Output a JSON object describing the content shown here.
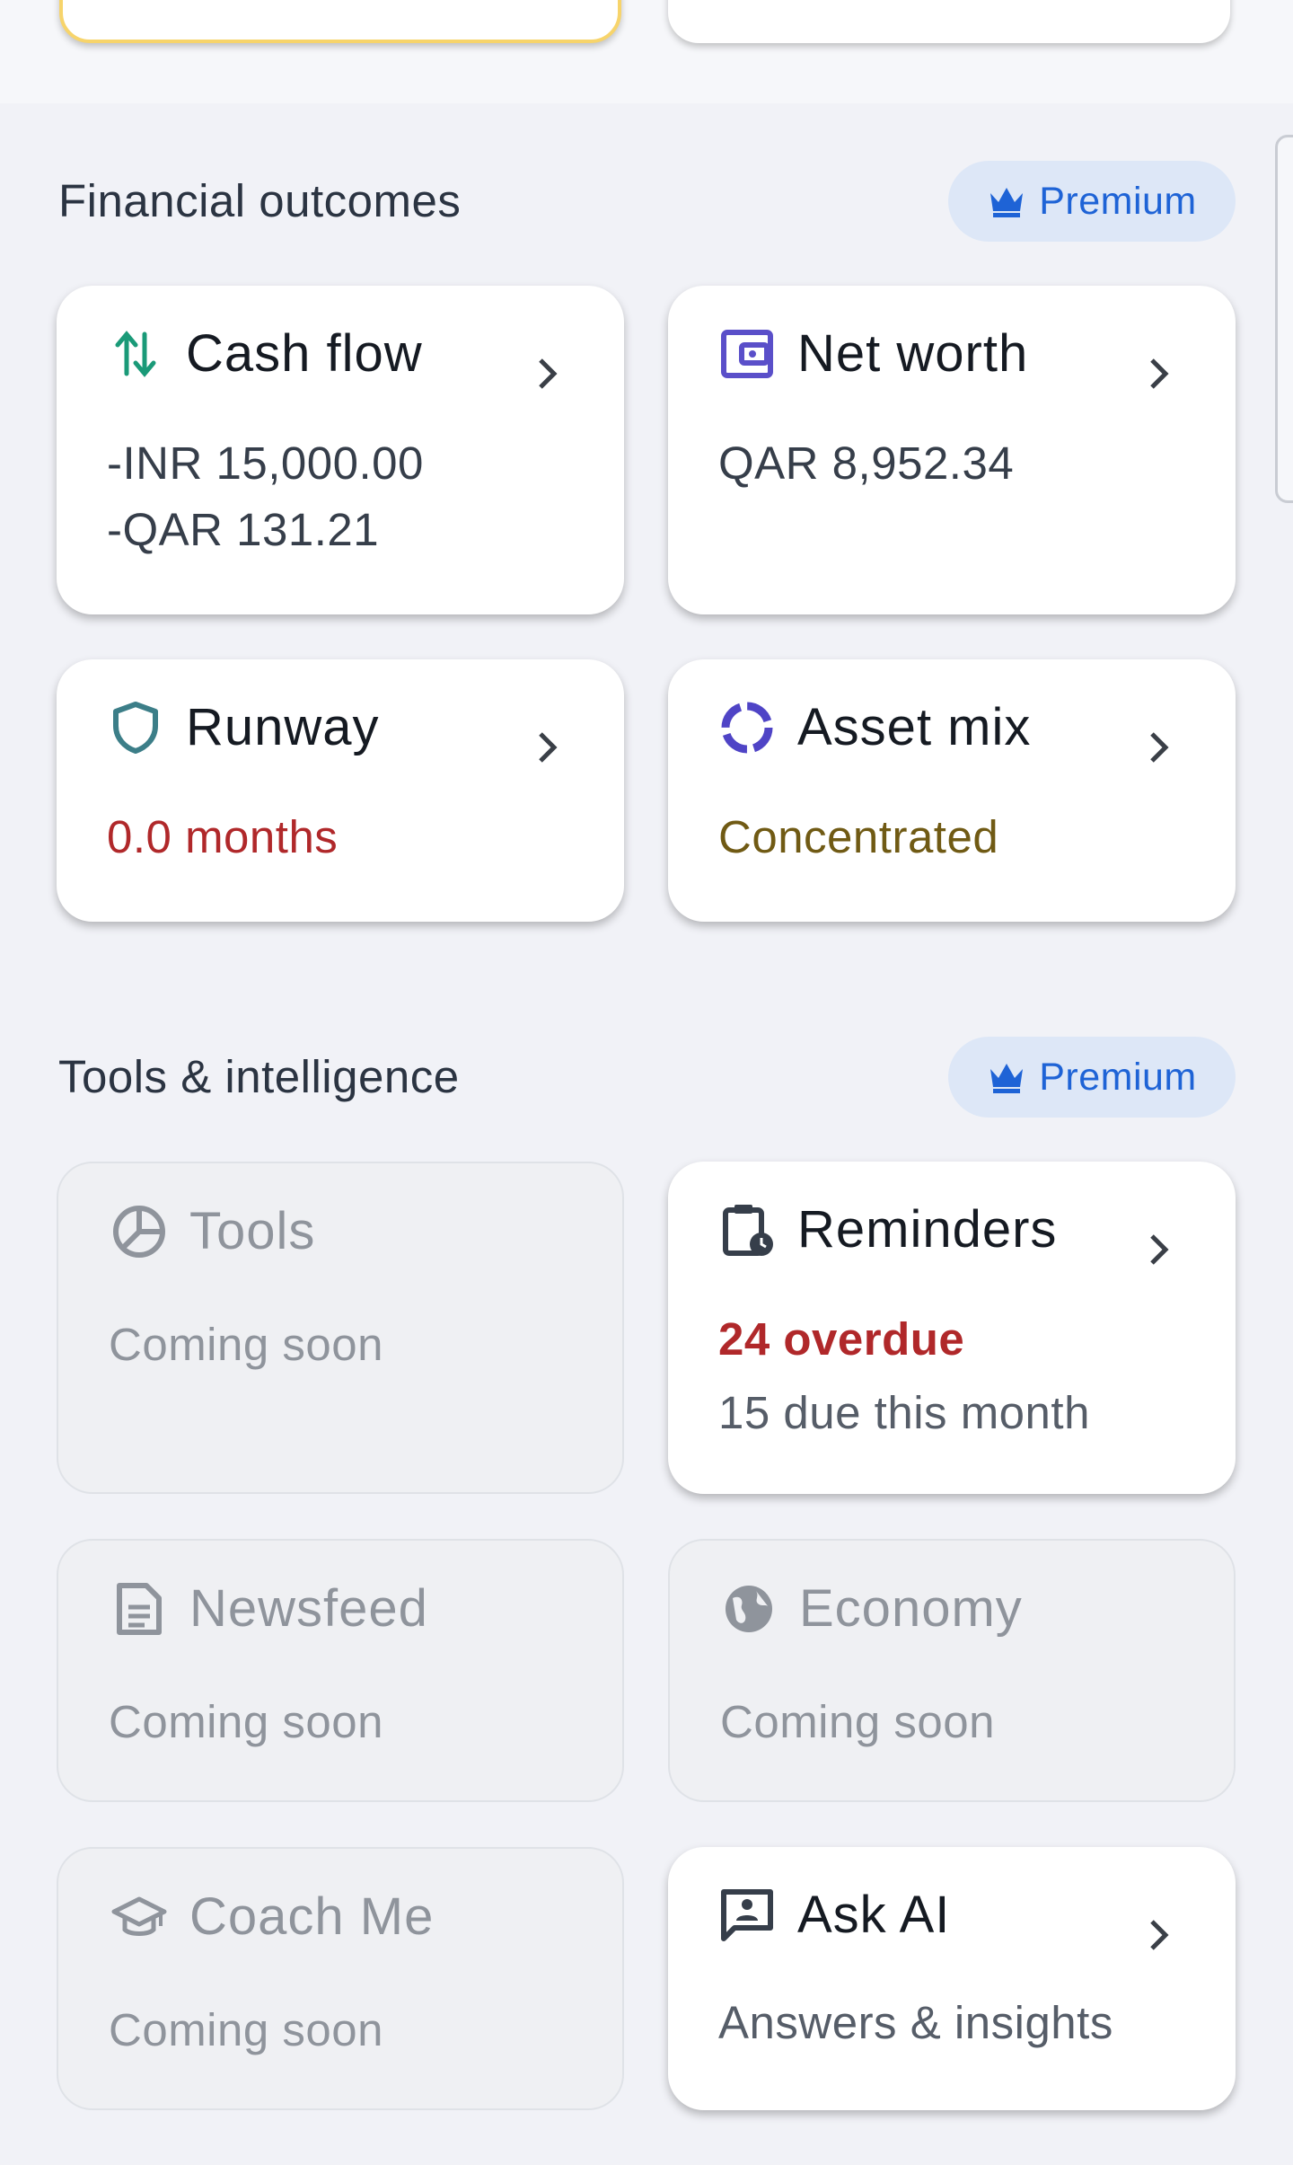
{
  "sections": {
    "financial": {
      "title": "Financial outcomes",
      "badge": "Premium"
    },
    "tools": {
      "title": "Tools & intelligence",
      "badge": "Premium"
    }
  },
  "cards": {
    "cash_flow": {
      "title": "Cash flow",
      "lines": [
        "-INR 15,000.00",
        "-QAR 131.21"
      ],
      "icon": "cash-flow-arrows-icon",
      "color": "#1a9a78"
    },
    "net_worth": {
      "title": "Net worth",
      "lines": [
        "QAR 8,952.34"
      ],
      "icon": "wallet-icon",
      "color": "#5a4fc9"
    },
    "runway": {
      "title": "Runway",
      "value": "0.0 months",
      "icon": "shield-icon",
      "color": "#3c7e88"
    },
    "asset_mix": {
      "title": "Asset mix",
      "value": "Concentrated",
      "icon": "donut-ring-icon",
      "color": "#4f44c6"
    },
    "tools": {
      "title": "Tools",
      "subtitle": "Coming soon",
      "icon": "pie-chart-icon"
    },
    "reminders": {
      "title": "Reminders",
      "overdue": "24 overdue",
      "due": "15 due this month",
      "icon": "clipboard-clock-icon"
    },
    "newsfeed": {
      "title": "Newsfeed",
      "subtitle": "Coming soon",
      "icon": "article-icon"
    },
    "economy": {
      "title": "Economy",
      "subtitle": "Coming soon",
      "icon": "globe-icon"
    },
    "coach_me": {
      "title": "Coach Me",
      "subtitle": "Coming soon",
      "icon": "graduation-cap-icon"
    },
    "ask_ai": {
      "title": "Ask AI",
      "subtitle": "Answers & insights",
      "icon": "chat-person-icon"
    }
  },
  "colors": {
    "premium": "#1e63d6",
    "alert": "#b0282a",
    "warning": "#705a14"
  }
}
